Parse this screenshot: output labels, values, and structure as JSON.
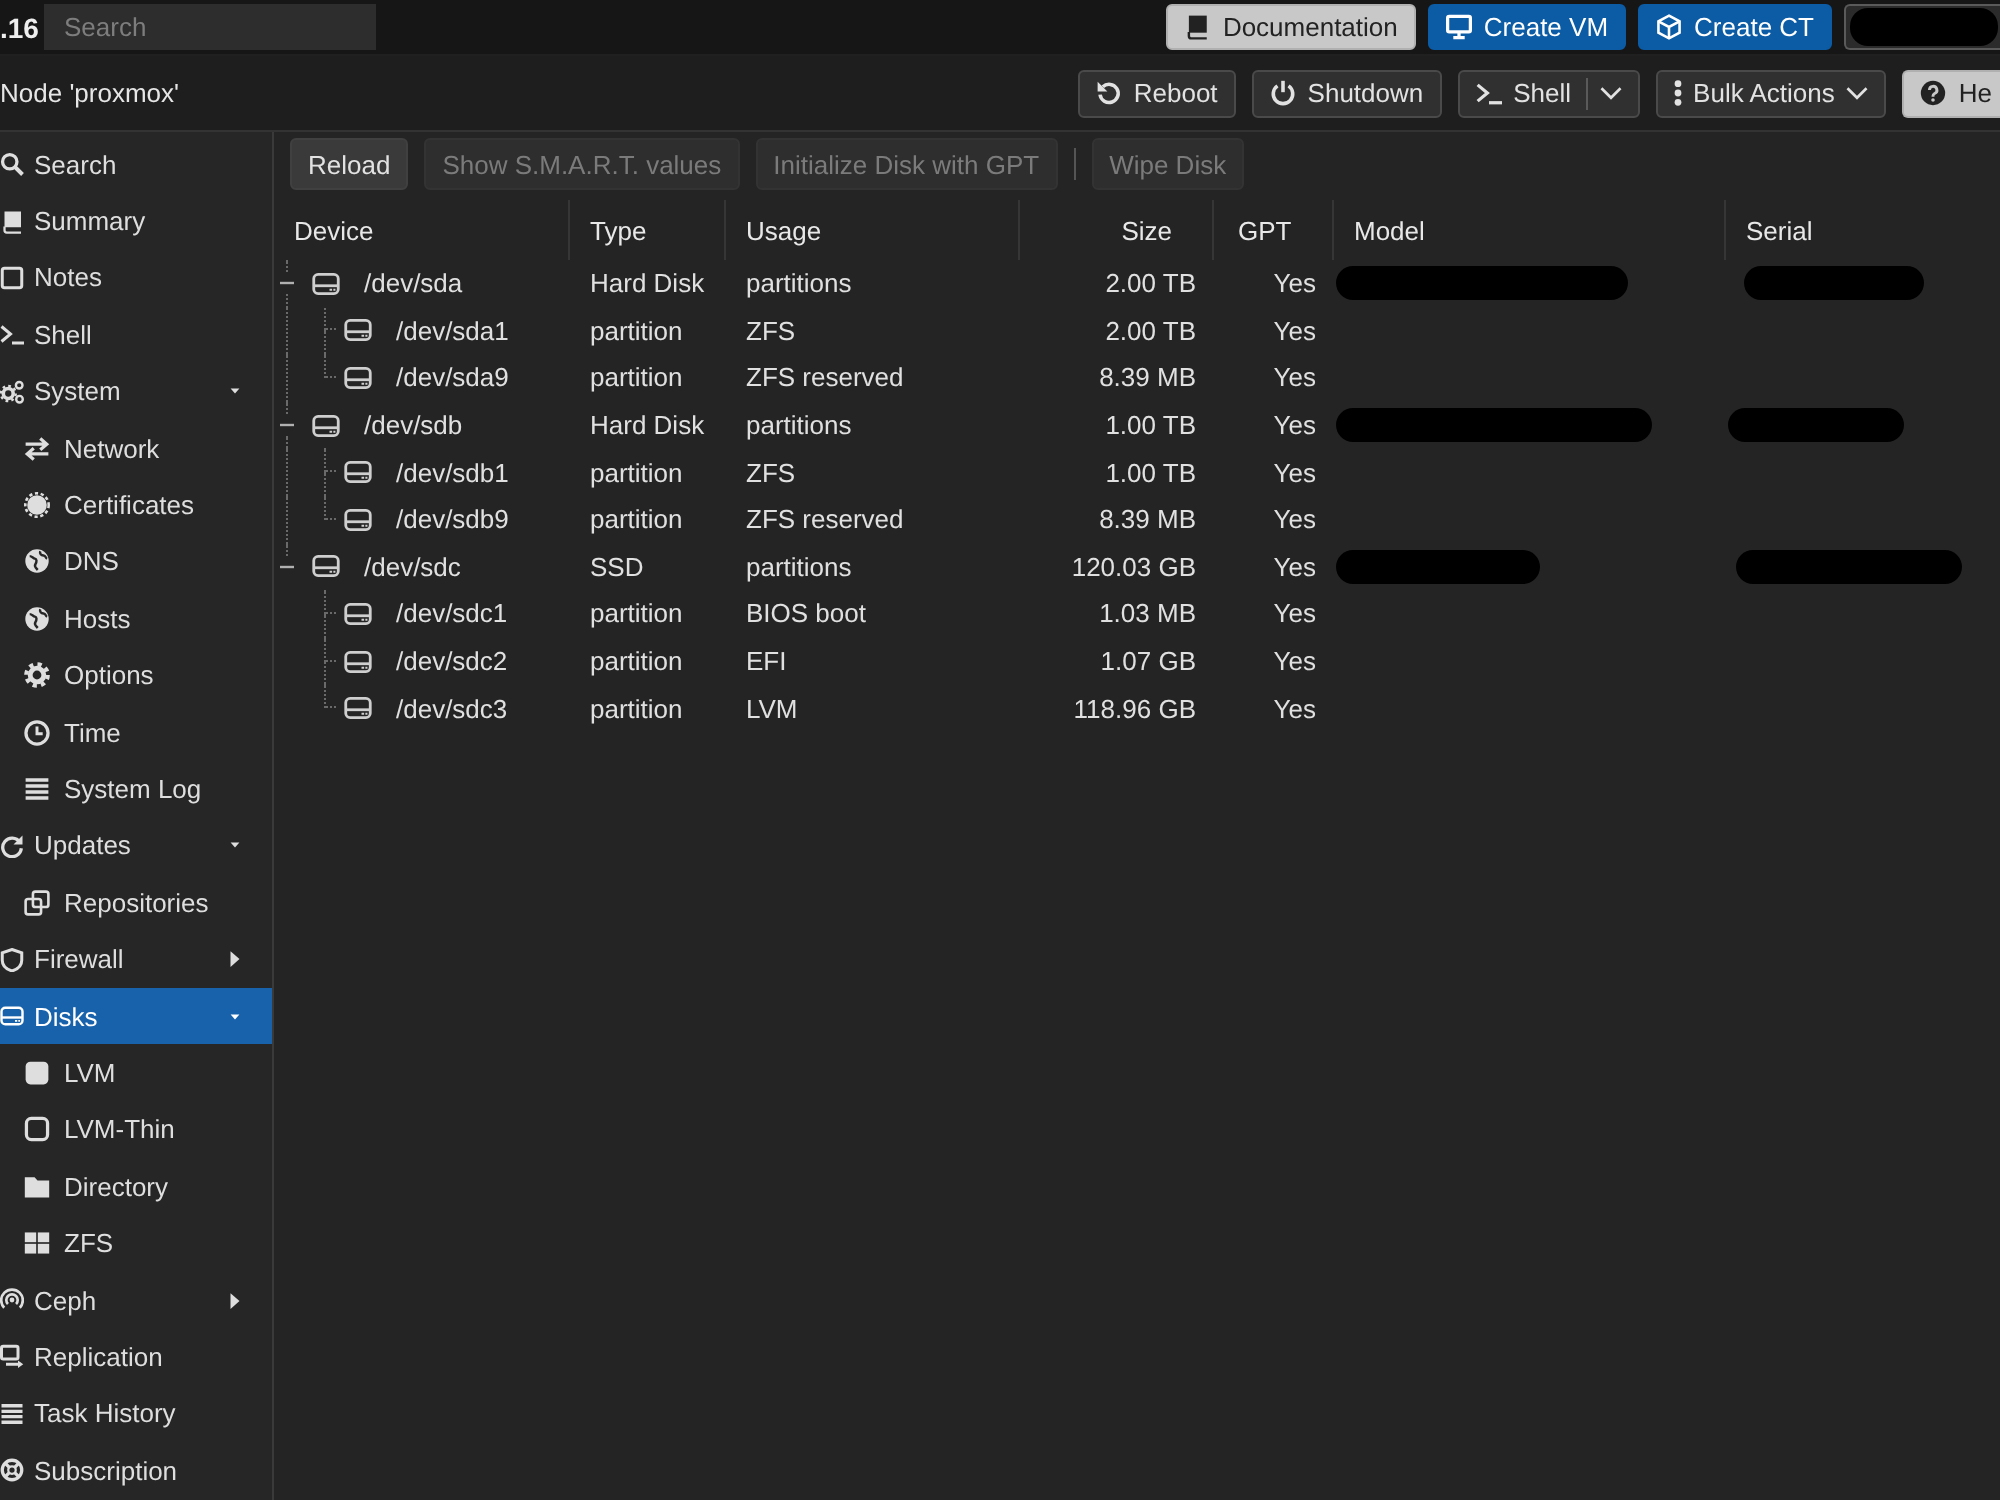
{
  "top_bar": {
    "version": ".16",
    "search": {
      "placeholder": "Search"
    },
    "buttons": [
      {
        "label": "Documentation",
        "kind": "light"
      },
      {
        "label": "Create VM",
        "kind": "primary"
      },
      {
        "label": "Create CT",
        "kind": "primary"
      }
    ],
    "user_menu": {
      "redacted": true
    }
  },
  "node_header": {
    "title": "Node 'proxmox'",
    "buttons": [
      {
        "label": "Reboot",
        "kind": "plain"
      },
      {
        "label": "Shutdown",
        "kind": "plain"
      },
      {
        "label": "Shell",
        "kind": "split"
      },
      {
        "label": "Bulk Actions",
        "kind": "menu"
      },
      {
        "label": "He",
        "kind": "light"
      }
    ]
  },
  "sidebar": {
    "items": [
      {
        "label": "Search",
        "selected": false
      },
      {
        "label": "Summary",
        "selected": false
      },
      {
        "label": "Notes",
        "selected": false
      },
      {
        "label": "Shell",
        "selected": false
      },
      {
        "label": "System",
        "selected": false,
        "expanded": true,
        "children": [
          {
            "label": "Network",
            "selected": false
          },
          {
            "label": "Certificates",
            "selected": false
          },
          {
            "label": "DNS",
            "selected": false
          },
          {
            "label": "Hosts",
            "selected": false
          },
          {
            "label": "Options",
            "selected": false
          },
          {
            "label": "Time",
            "selected": false
          },
          {
            "label": "System Log",
            "selected": false
          }
        ]
      },
      {
        "label": "Updates",
        "selected": false,
        "expanded": true,
        "children": [
          {
            "label": "Repositories",
            "selected": false
          }
        ]
      },
      {
        "label": "Firewall",
        "selected": false,
        "expanded": false
      },
      {
        "label": "Disks",
        "selected": true,
        "expanded": true,
        "children": [
          {
            "label": "LVM",
            "selected": false
          },
          {
            "label": "LVM-Thin",
            "selected": false
          },
          {
            "label": "Directory",
            "selected": false
          },
          {
            "label": "ZFS",
            "selected": false
          }
        ]
      },
      {
        "label": "Ceph",
        "selected": false,
        "expanded": false
      },
      {
        "label": "Replication",
        "selected": false
      },
      {
        "label": "Task History",
        "selected": false
      },
      {
        "label": "Subscription",
        "selected": false
      }
    ]
  },
  "toolbar": {
    "items": [
      {
        "kind": "button",
        "label": "Reload",
        "disabled": false
      },
      {
        "kind": "button",
        "label": "Show S.M.A.R.T. values",
        "disabled": true
      },
      {
        "kind": "button",
        "label": "Initialize Disk with GPT",
        "disabled": true
      },
      {
        "kind": "separator"
      },
      {
        "kind": "button",
        "label": "Wipe Disk",
        "disabled": true
      }
    ]
  },
  "table": {
    "columns": [
      "Device",
      "Type",
      "Usage",
      "Size",
      "GPT",
      "Model",
      "Serial"
    ],
    "rows": [
      {
        "device": "/dev/sda",
        "type": "Hard Disk",
        "usage": "partitions",
        "size": "2.00 TB",
        "gpt": "Yes",
        "redacted": true,
        "expanded": true,
        "children": [
          {
            "device": "/dev/sda1",
            "type": "partition",
            "usage": "ZFS",
            "size": "2.00 TB",
            "gpt": "Yes",
            "redacted": false
          },
          {
            "device": "/dev/sda9",
            "type": "partition",
            "usage": "ZFS reserved",
            "size": "8.39 MB",
            "gpt": "Yes",
            "redacted": false
          }
        ]
      },
      {
        "device": "/dev/sdb",
        "type": "Hard Disk",
        "usage": "partitions",
        "size": "1.00 TB",
        "gpt": "Yes",
        "redacted": true,
        "expanded": true,
        "children": [
          {
            "device": "/dev/sdb1",
            "type": "partition",
            "usage": "ZFS",
            "size": "1.00 TB",
            "gpt": "Yes",
            "redacted": false
          },
          {
            "device": "/dev/sdb9",
            "type": "partition",
            "usage": "ZFS reserved",
            "size": "8.39 MB",
            "gpt": "Yes",
            "redacted": false
          }
        ]
      },
      {
        "device": "/dev/sdc",
        "type": "SSD",
        "usage": "partitions",
        "size": "120.03 GB",
        "gpt": "Yes",
        "redacted": true,
        "expanded": true,
        "children": [
          {
            "device": "/dev/sdc1",
            "type": "partition",
            "usage": "BIOS boot",
            "size": "1.03 MB",
            "gpt": "Yes",
            "redacted": false
          },
          {
            "device": "/dev/sdc2",
            "type": "partition",
            "usage": "EFI",
            "size": "1.07 GB",
            "gpt": "Yes",
            "redacted": false
          },
          {
            "device": "/dev/sdc3",
            "type": "partition",
            "usage": "LVM",
            "size": "118.96 GB",
            "gpt": "Yes",
            "redacted": false
          }
        ]
      }
    ]
  }
}
